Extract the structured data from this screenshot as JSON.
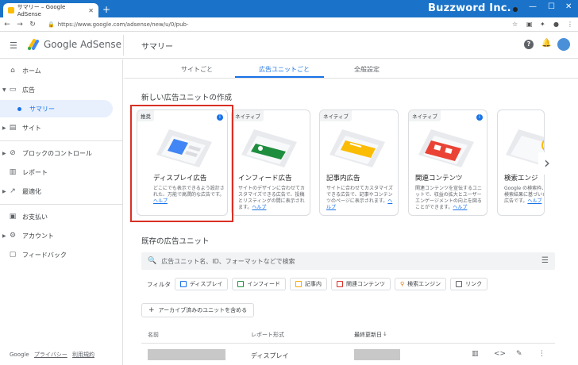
{
  "browser": {
    "tab_title": "サマリー – Google AdSense",
    "url": "https://www.google.com/adsense/new/u/0/pub-",
    "watermark": "Buzzword Inc."
  },
  "header": {
    "logo_text": "Google AdSense",
    "page_title": "サマリー"
  },
  "sidebar": {
    "items": [
      {
        "label": "ホーム"
      },
      {
        "label": "広告"
      },
      {
        "label": "サマリー"
      },
      {
        "label": "サイト"
      },
      {
        "label": "ブロックのコントロール"
      },
      {
        "label": "レポート"
      },
      {
        "label": "最適化"
      },
      {
        "label": "お支払い"
      },
      {
        "label": "アカウント"
      },
      {
        "label": "フィードバック"
      }
    ],
    "footer": {
      "google": "Google",
      "privacy": "プライバシー",
      "terms": "利用規約"
    }
  },
  "tabs": [
    {
      "label": "サイトごと"
    },
    {
      "label": "広告ユニットごと"
    },
    {
      "label": "全般設定"
    }
  ],
  "create_section": {
    "title": "新しい広告ユニットの作成",
    "cards": [
      {
        "tag": "推奨",
        "title": "ディスプレイ広告",
        "desc": "どこにでも表示できるよう設計された、万能で高潤的な広告です。",
        "help": "ヘルプ"
      },
      {
        "tag": "ネイティブ",
        "title": "インフィード広告",
        "desc": "サイトのデザインに合わせてカスタマイズできる広告で、投稿とリスティングの間に表示されます。",
        "help": "ヘルプ"
      },
      {
        "tag": "ネイティブ",
        "title": "記事内広告",
        "desc": "サイトに合わせてカスタマイズできる広告で、記事やコンテンツのページに表示されます。",
        "help": "ヘルプ"
      },
      {
        "tag": "ネイティブ",
        "title": "関連コンテンツ",
        "desc": "関連コンテンツを宣伝するユニットで、収益の拡大とユーザー エンゲージメントの向上を図ることができます。",
        "help": "ヘルプ"
      },
      {
        "tag": "",
        "title": "検索エンジ",
        "desc": "Google の検索枠、検索結果に基づいた広告です。",
        "help": "ヘルプ"
      }
    ]
  },
  "existing_section": {
    "title": "既存の広告ユニット",
    "search_placeholder": "広告ユニット名、ID、フォーマットなどで検索",
    "filter_label": "フィルタ",
    "filters": [
      {
        "label": "ディスプレイ",
        "color": "#1a73e8"
      },
      {
        "label": "インフィード",
        "color": "#1e8e3e"
      },
      {
        "label": "記事内",
        "color": "#f9ab00"
      },
      {
        "label": "関連コンテンツ",
        "color": "#d93025"
      },
      {
        "label": "検索エンジン",
        "color": "#e37400"
      },
      {
        "label": "リンク",
        "color": "#5f6368"
      }
    ],
    "archive_button": "アーカイブ済みのユニットを含める",
    "columns": {
      "name": "名前",
      "report_format": "レポート形式",
      "last_updated": "最終更新日"
    },
    "rows": [
      {
        "report_format": "ディスプレイ"
      }
    ]
  }
}
